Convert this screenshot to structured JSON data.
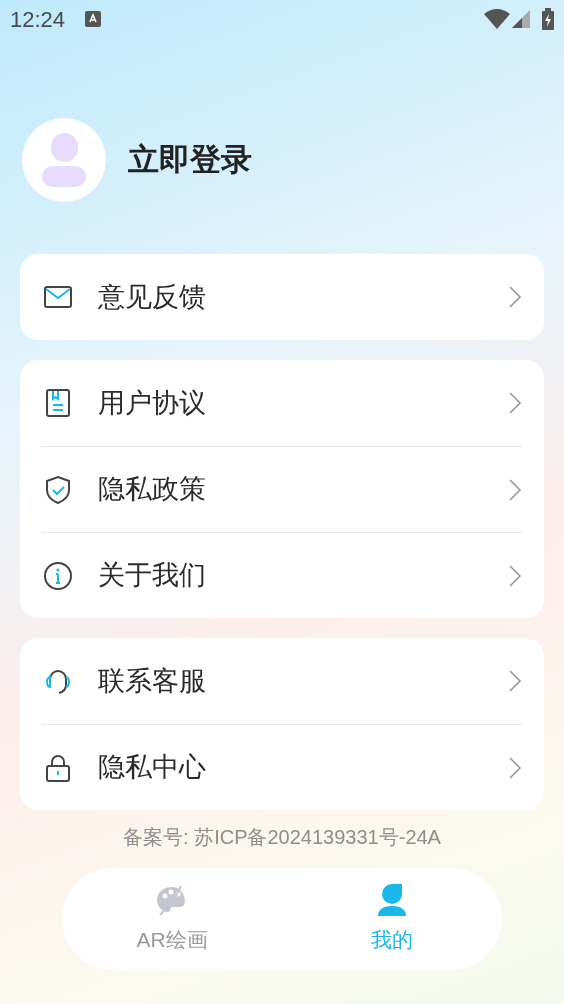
{
  "status_bar": {
    "time": "12:24"
  },
  "profile": {
    "login_label": "立即登录"
  },
  "menu_groups": [
    {
      "items": [
        {
          "kind": "mail",
          "label": "意见反馈"
        }
      ]
    },
    {
      "items": [
        {
          "kind": "book",
          "label": "用户协议"
        },
        {
          "kind": "shield",
          "label": "隐私政策"
        },
        {
          "kind": "info",
          "label": "关于我们"
        }
      ]
    },
    {
      "items": [
        {
          "kind": "headset",
          "label": "联系客服"
        },
        {
          "kind": "lock",
          "label": "隐私中心"
        }
      ]
    }
  ],
  "icp": "备案号: 苏ICP备2024139331号-24A",
  "tabs": [
    {
      "kind": "palette",
      "label": "AR绘画",
      "selected": false
    },
    {
      "kind": "person",
      "label": "我的",
      "selected": true
    }
  ]
}
